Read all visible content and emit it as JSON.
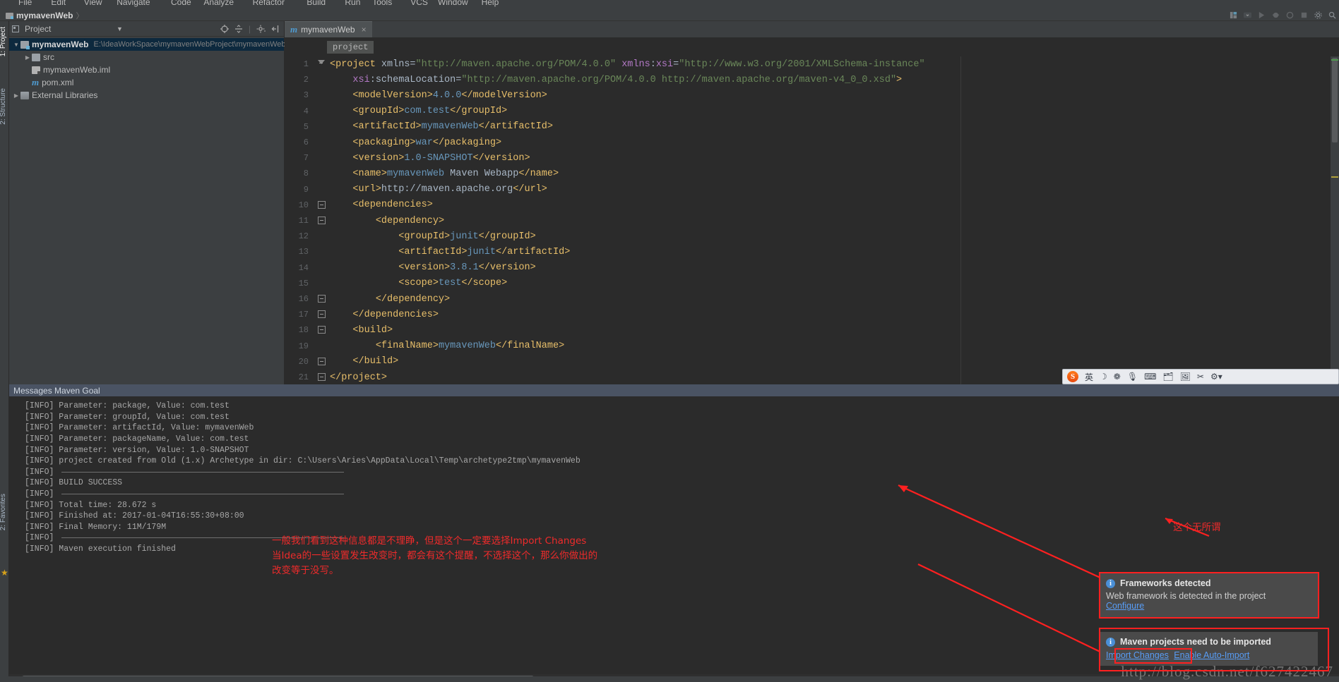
{
  "window": {
    "menu_items": [
      "File",
      "Edit",
      "View",
      "Navigate",
      "Code",
      "Analyze",
      "Refactor",
      "Build",
      "Run",
      "Tools",
      "VCS",
      "Window",
      "Help"
    ],
    "breadcrumb_project": "mymavenWeb",
    "breadcrumb_sep": "〉"
  },
  "left_strip": {
    "tabs": [
      "1: Project",
      "2: Structure"
    ],
    "bottom_tabs": [
      "2: Favorites"
    ]
  },
  "project_panel": {
    "title": "Project",
    "icons": [
      "target-icon",
      "collapse-icon",
      "gear-icon",
      "hide-icon"
    ],
    "tree": [
      {
        "label": "mymavenWeb",
        "path": "E:\\IdeaWorkSpace\\mymavenWebProject\\mymavenWeb",
        "icon": "module-folder-icon",
        "selected": true,
        "expanded": true,
        "indent": 0
      },
      {
        "label": "src",
        "path": "",
        "icon": "folder-icon",
        "selected": false,
        "expanded": false,
        "indent": 1
      },
      {
        "label": "mymavenWeb.iml",
        "path": "",
        "icon": "iml-file-icon",
        "selected": false,
        "indent": 1
      },
      {
        "label": "pom.xml",
        "path": "",
        "icon": "maven-m-icon",
        "selected": false,
        "indent": 1
      },
      {
        "label": "External Libraries",
        "path": "",
        "icon": "library-icon",
        "selected": false,
        "expanded": false,
        "indent": 0
      }
    ]
  },
  "editor": {
    "tab_label": "mymavenWeb",
    "tab_icon": "maven-m-icon",
    "tab_close": "×",
    "breadcrumb_chip": "project",
    "lines": [
      {
        "n": 1,
        "fold": "tri",
        "text": "<project xmlns=\"http://maven.apache.org/POM/4.0.0\" xmlns:xsi=\"http://www.w3.org/2001/XMLSchema-instance\""
      },
      {
        "n": 2,
        "fold": "",
        "text": "    xsi:schemaLocation=\"http://maven.apache.org/POM/4.0.0 http://maven.apache.org/maven-v4_0_0.xsd\">"
      },
      {
        "n": 3,
        "fold": "",
        "text": "    <modelVersion>4.0.0</modelVersion>"
      },
      {
        "n": 4,
        "fold": "",
        "text": "    <groupId>com.test</groupId>"
      },
      {
        "n": 5,
        "fold": "",
        "text": "    <artifactId>mymavenWeb</artifactId>"
      },
      {
        "n": 6,
        "fold": "",
        "text": "    <packaging>war</packaging>"
      },
      {
        "n": 7,
        "fold": "",
        "text": "    <version>1.0-SNAPSHOT</version>"
      },
      {
        "n": 8,
        "fold": "",
        "text": "    <name>mymavenWeb Maven Webapp</name>"
      },
      {
        "n": 9,
        "fold": "",
        "text": "    <url>http://maven.apache.org</url>"
      },
      {
        "n": 10,
        "fold": "box",
        "text": "    <dependencies>"
      },
      {
        "n": 11,
        "fold": "box",
        "text": "        <dependency>"
      },
      {
        "n": 12,
        "fold": "",
        "text": "            <groupId>junit</groupId>"
      },
      {
        "n": 13,
        "fold": "",
        "text": "            <artifactId>junit</artifactId>"
      },
      {
        "n": 14,
        "fold": "",
        "text": "            <version>3.8.1</version>"
      },
      {
        "n": 15,
        "fold": "",
        "text": "            <scope>test</scope>"
      },
      {
        "n": 16,
        "fold": "end",
        "text": "        </dependency>"
      },
      {
        "n": 17,
        "fold": "end",
        "text": "    </dependencies>"
      },
      {
        "n": 18,
        "fold": "box",
        "text": "    <build>"
      },
      {
        "n": 19,
        "fold": "",
        "text": "        <finalName>mymavenWeb</finalName>"
      },
      {
        "n": 20,
        "fold": "end",
        "text": "    </build>"
      },
      {
        "n": 21,
        "fold": "end",
        "text": "</project>"
      }
    ]
  },
  "ime_bar": {
    "logo": "S",
    "items": [
      "英",
      "☽",
      "❁",
      "🎙",
      "⌨",
      "🗂",
      "🖼",
      "✂",
      "⚙▾",
      "▾"
    ]
  },
  "console": {
    "title": "Messages Maven Goal",
    "lines": [
      {
        "text": "[INFO] Parameter: package, Value: com.test",
        "rule": false
      },
      {
        "text": "[INFO] Parameter: groupId, Value: com.test",
        "rule": false
      },
      {
        "text": "[INFO] Parameter: artifactId, Value: mymavenWeb",
        "rule": false
      },
      {
        "text": "[INFO] Parameter: packageName, Value: com.test",
        "rule": false
      },
      {
        "text": "[INFO] Parameter: version, Value: 1.0-SNAPSHOT",
        "rule": false
      },
      {
        "text": "[INFO] project created from Old (1.x) Archetype in dir: C:\\Users\\Aries\\AppData\\Local\\Temp\\archetype2tmp\\mymavenWeb",
        "rule": false
      },
      {
        "text": "[INFO] ",
        "rule": true
      },
      {
        "text": "[INFO] BUILD SUCCESS",
        "rule": false
      },
      {
        "text": "[INFO] ",
        "rule": true
      },
      {
        "text": "[INFO] Total time: 28.672 s",
        "rule": false
      },
      {
        "text": "[INFO] Finished at: 2017-01-04T16:55:30+08:00",
        "rule": false
      },
      {
        "text": "[INFO] Final Memory: 11M/179M",
        "rule": false
      },
      {
        "text": "[INFO] ",
        "rule": true
      },
      {
        "text": "[INFO] Maven execution finished",
        "rule": false
      }
    ]
  },
  "annotations": {
    "note_main_line1": "一般我们看到这种信息都是不理睁，但是这个一定要选择Import Changes",
    "note_main_line2": "当Idea的一些设置发生改变时，都会有这个提醒，不选择这个，那么你做出的",
    "note_main_line3": "改变等于没写。",
    "note_right": "这个无所谓"
  },
  "notifications": [
    {
      "icon": "info-icon",
      "title": "Frameworks detected",
      "body": "Web framework is detected in the project",
      "links": [
        "Configure"
      ]
    },
    {
      "icon": "info-icon",
      "title": "Maven projects need to be imported",
      "body": "",
      "links": [
        "Import Changes",
        "Enable Auto-Import"
      ]
    }
  ],
  "watermark": "http://blog.csdn.net/f627422467",
  "colors": {
    "accent_blue": "#4a8fd6",
    "link_blue": "#589df6",
    "annotation_red": "#ef2b2b",
    "selection_blue": "#0d293e",
    "editor_bg": "#2b2b2b",
    "panel_bg": "#3c3f41"
  }
}
